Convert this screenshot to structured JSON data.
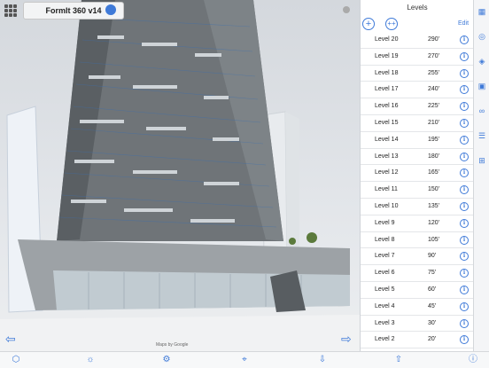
{
  "app": {
    "title": "FormIt 360 v14"
  },
  "viewport": {
    "credit": "Maps by Google"
  },
  "panel": {
    "title": "Levels",
    "edit_label": "Edit",
    "levels": [
      {
        "name": "Level 20",
        "elevation": "290'"
      },
      {
        "name": "Level 19",
        "elevation": "270'"
      },
      {
        "name": "Level 18",
        "elevation": "255'"
      },
      {
        "name": "Level 17",
        "elevation": "240'"
      },
      {
        "name": "Level 16",
        "elevation": "225'"
      },
      {
        "name": "Level 15",
        "elevation": "210'"
      },
      {
        "name": "Level 14",
        "elevation": "195'"
      },
      {
        "name": "Level 13",
        "elevation": "180'"
      },
      {
        "name": "Level 12",
        "elevation": "165'"
      },
      {
        "name": "Level 11",
        "elevation": "150'"
      },
      {
        "name": "Level 10",
        "elevation": "135'"
      },
      {
        "name": "Level 9",
        "elevation": "120'"
      },
      {
        "name": "Level 8",
        "elevation": "105'"
      },
      {
        "name": "Level 7",
        "elevation": "90'"
      },
      {
        "name": "Level 6",
        "elevation": "75'"
      },
      {
        "name": "Level 5",
        "elevation": "60'"
      },
      {
        "name": "Level 4",
        "elevation": "45'"
      },
      {
        "name": "Level 3",
        "elevation": "30'"
      },
      {
        "name": "Level 2",
        "elevation": "20'"
      },
      {
        "name": "Level 1",
        "elevation": "0'"
      }
    ]
  },
  "sidebar_icons": [
    "ruler-icon",
    "material-icon",
    "layers-icon",
    "glasses-icon",
    "sliders-icon",
    "groups-icon"
  ],
  "toolbar_icons": [
    "cube-icon",
    "sun-icon",
    "settings-icon",
    "location-icon",
    "import-icon",
    "share-icon",
    "info-icon"
  ],
  "colors": {
    "accent": "#3f7ad8",
    "panel_bg": "#ffffff",
    "sidebar_bg": "#f4f5f7"
  }
}
